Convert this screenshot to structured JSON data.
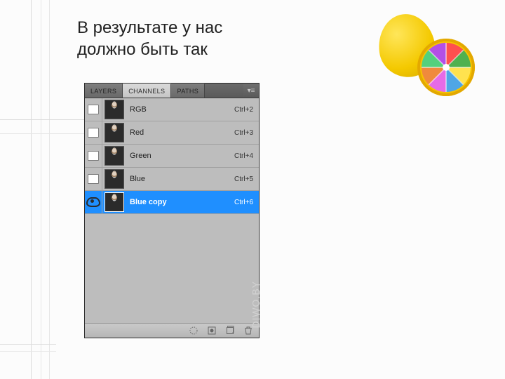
{
  "heading_line1": "В результате у нас",
  "heading_line2": "должно быть так",
  "panel": {
    "tabs": [
      {
        "label": "LAYERS",
        "state": "inactive"
      },
      {
        "label": "CHANNELS",
        "state": "active"
      },
      {
        "label": "PATHS",
        "state": "inactive"
      }
    ],
    "channels": [
      {
        "name": "RGB",
        "shortcut": "Ctrl+2",
        "visible": false,
        "selected": false
      },
      {
        "name": "Red",
        "shortcut": "Ctrl+3",
        "visible": false,
        "selected": false
      },
      {
        "name": "Green",
        "shortcut": "Ctrl+4",
        "visible": false,
        "selected": false
      },
      {
        "name": "Blue",
        "shortcut": "Ctrl+5",
        "visible": false,
        "selected": false
      },
      {
        "name": "Blue copy",
        "shortcut": "Ctrl+6",
        "visible": true,
        "selected": true
      }
    ],
    "watermark": "DIWO.BY"
  }
}
